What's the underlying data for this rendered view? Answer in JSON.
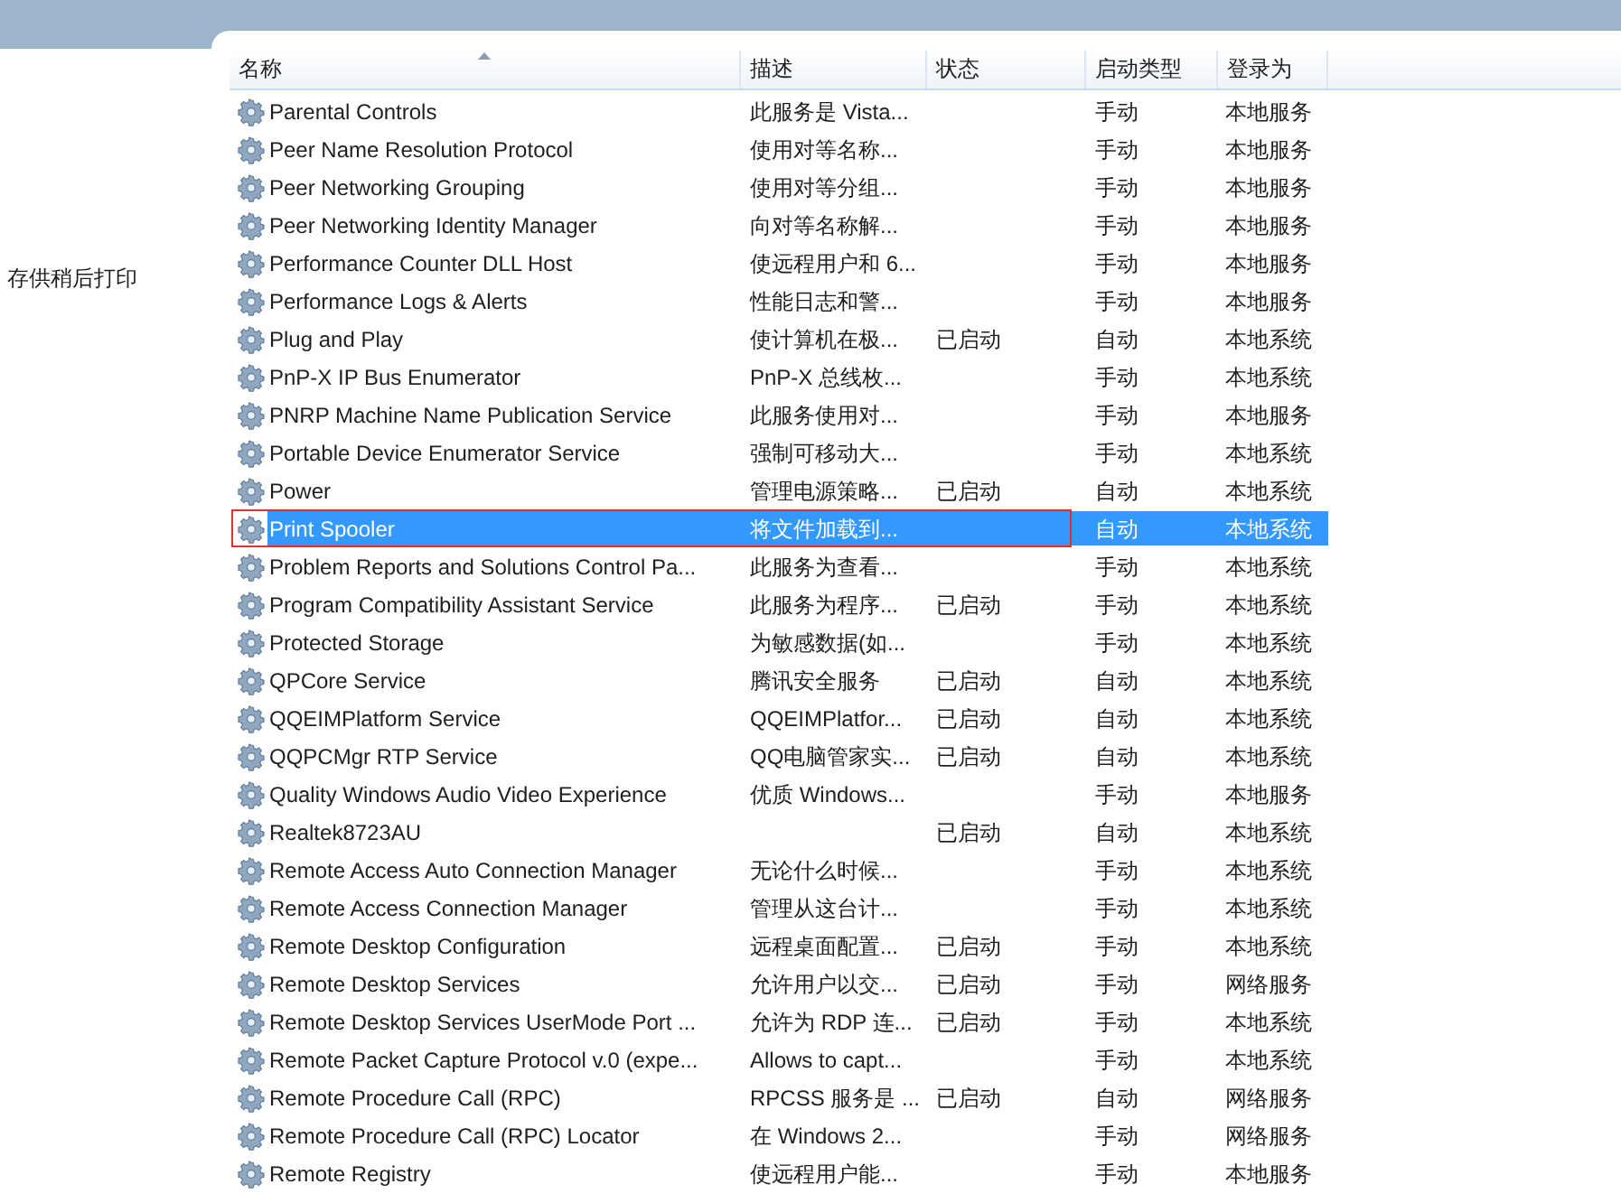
{
  "side_panel": {
    "text": "存供稍后打印"
  },
  "table": {
    "columns": [
      {
        "label": "名称",
        "sorted": true
      },
      {
        "label": "描述",
        "sorted": false
      },
      {
        "label": "状态",
        "sorted": false
      },
      {
        "label": "启动类型",
        "sorted": false
      },
      {
        "label": "登录为",
        "sorted": false
      }
    ],
    "rows": [
      {
        "name": "Parental Controls",
        "description": "此服务是 Vista...",
        "status": "",
        "startup": "手动",
        "logon": "本地服务",
        "selected": false,
        "outlined": false
      },
      {
        "name": "Peer Name Resolution Protocol",
        "description": "使用对等名称...",
        "status": "",
        "startup": "手动",
        "logon": "本地服务",
        "selected": false,
        "outlined": false
      },
      {
        "name": "Peer Networking Grouping",
        "description": "使用对等分组...",
        "status": "",
        "startup": "手动",
        "logon": "本地服务",
        "selected": false,
        "outlined": false
      },
      {
        "name": "Peer Networking Identity Manager",
        "description": "向对等名称解...",
        "status": "",
        "startup": "手动",
        "logon": "本地服务",
        "selected": false,
        "outlined": false
      },
      {
        "name": "Performance Counter DLL Host",
        "description": "使远程用户和 6...",
        "status": "",
        "startup": "手动",
        "logon": "本地服务",
        "selected": false,
        "outlined": false
      },
      {
        "name": "Performance Logs & Alerts",
        "description": "性能日志和警...",
        "status": "",
        "startup": "手动",
        "logon": "本地服务",
        "selected": false,
        "outlined": false
      },
      {
        "name": "Plug and Play",
        "description": "使计算机在极...",
        "status": "已启动",
        "startup": "自动",
        "logon": "本地系统",
        "selected": false,
        "outlined": false
      },
      {
        "name": "PnP-X IP Bus Enumerator",
        "description": "PnP-X 总线枚...",
        "status": "",
        "startup": "手动",
        "logon": "本地系统",
        "selected": false,
        "outlined": false
      },
      {
        "name": "PNRP Machine Name Publication Service",
        "description": "此服务使用对...",
        "status": "",
        "startup": "手动",
        "logon": "本地服务",
        "selected": false,
        "outlined": false
      },
      {
        "name": "Portable Device Enumerator Service",
        "description": "强制可移动大...",
        "status": "",
        "startup": "手动",
        "logon": "本地系统",
        "selected": false,
        "outlined": false
      },
      {
        "name": "Power",
        "description": "管理电源策略...",
        "status": "已启动",
        "startup": "自动",
        "logon": "本地系统",
        "selected": false,
        "outlined": false
      },
      {
        "name": "Print Spooler",
        "description": "将文件加载到...",
        "status": "",
        "startup": "自动",
        "logon": "本地系统",
        "selected": true,
        "outlined": true
      },
      {
        "name": "Problem Reports and Solutions Control Pa...",
        "description": "此服务为查看...",
        "status": "",
        "startup": "手动",
        "logon": "本地系统",
        "selected": false,
        "outlined": false
      },
      {
        "name": "Program Compatibility Assistant Service",
        "description": "此服务为程序...",
        "status": "已启动",
        "startup": "手动",
        "logon": "本地系统",
        "selected": false,
        "outlined": false
      },
      {
        "name": "Protected Storage",
        "description": "为敏感数据(如...",
        "status": "",
        "startup": "手动",
        "logon": "本地系统",
        "selected": false,
        "outlined": false
      },
      {
        "name": "QPCore Service",
        "description": "腾讯安全服务",
        "status": "已启动",
        "startup": "自动",
        "logon": "本地系统",
        "selected": false,
        "outlined": false
      },
      {
        "name": "QQEIMPlatform Service",
        "description": "QQEIMPlatfor...",
        "status": "已启动",
        "startup": "自动",
        "logon": "本地系统",
        "selected": false,
        "outlined": false
      },
      {
        "name": "QQPCMgr RTP Service",
        "description": "QQ电脑管家实...",
        "status": "已启动",
        "startup": "自动",
        "logon": "本地系统",
        "selected": false,
        "outlined": false
      },
      {
        "name": "Quality Windows Audio Video Experience",
        "description": "优质 Windows...",
        "status": "",
        "startup": "手动",
        "logon": "本地服务",
        "selected": false,
        "outlined": false
      },
      {
        "name": "Realtek8723AU",
        "description": "",
        "status": "已启动",
        "startup": "自动",
        "logon": "本地系统",
        "selected": false,
        "outlined": false
      },
      {
        "name": "Remote Access Auto Connection Manager",
        "description": "无论什么时候...",
        "status": "",
        "startup": "手动",
        "logon": "本地系统",
        "selected": false,
        "outlined": false
      },
      {
        "name": "Remote Access Connection Manager",
        "description": "管理从这台计...",
        "status": "",
        "startup": "手动",
        "logon": "本地系统",
        "selected": false,
        "outlined": false
      },
      {
        "name": "Remote Desktop Configuration",
        "description": "远程桌面配置...",
        "status": "已启动",
        "startup": "手动",
        "logon": "本地系统",
        "selected": false,
        "outlined": false
      },
      {
        "name": "Remote Desktop Services",
        "description": "允许用户以交...",
        "status": "已启动",
        "startup": "手动",
        "logon": "网络服务",
        "selected": false,
        "outlined": false
      },
      {
        "name": "Remote Desktop Services UserMode Port ...",
        "description": "允许为 RDP 连...",
        "status": "已启动",
        "startup": "手动",
        "logon": "本地系统",
        "selected": false,
        "outlined": false
      },
      {
        "name": "Remote Packet Capture Protocol v.0 (expe...",
        "description": "Allows to capt...",
        "status": "",
        "startup": "手动",
        "logon": "本地系统",
        "selected": false,
        "outlined": false
      },
      {
        "name": "Remote Procedure Call (RPC)",
        "description": "RPCSS 服务是 ...",
        "status": "已启动",
        "startup": "自动",
        "logon": "网络服务",
        "selected": false,
        "outlined": false
      },
      {
        "name": "Remote Procedure Call (RPC) Locator",
        "description": "在 Windows 2...",
        "status": "",
        "startup": "手动",
        "logon": "网络服务",
        "selected": false,
        "outlined": false
      },
      {
        "name": "Remote Registry",
        "description": "使远程用户能...",
        "status": "",
        "startup": "手动",
        "logon": "本地服务",
        "selected": false,
        "outlined": false
      }
    ]
  }
}
